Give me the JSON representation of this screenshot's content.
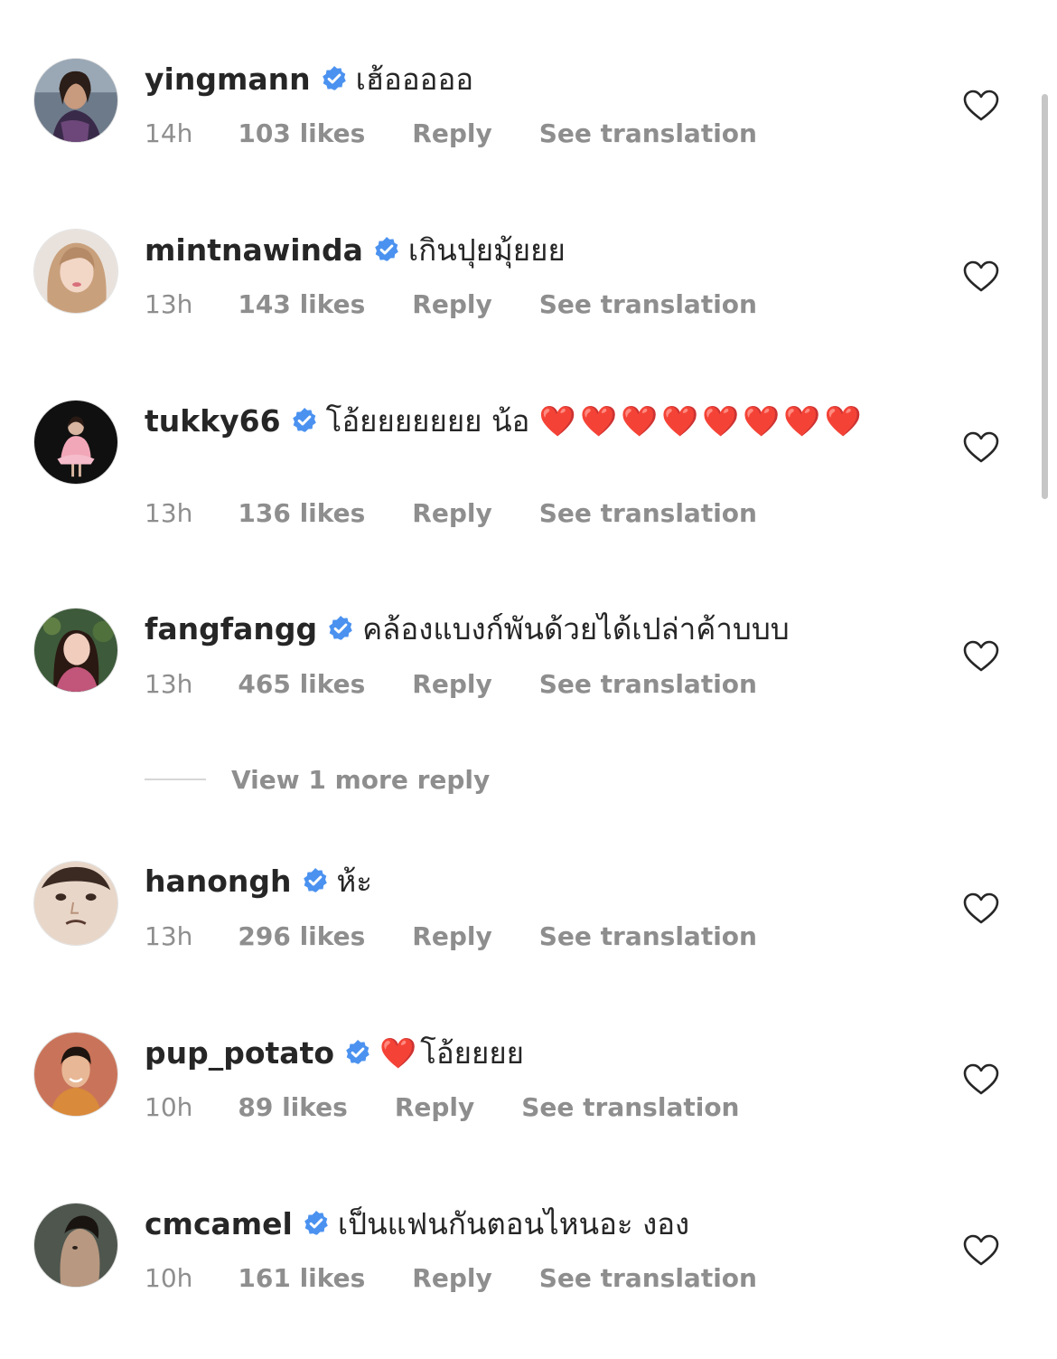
{
  "colors": {
    "verified_badge": "#4b92f0",
    "meta_text": "#8e8e8e",
    "heart_emoji": "#e0283c",
    "scrollbar": "#c6c6c6"
  },
  "comments": [
    {
      "username": "yingmann",
      "text": "เฮ้อออออ",
      "time": "14h",
      "likes": "103 likes",
      "reply": "Reply",
      "translate": "See translation",
      "icon": "heart-outline-icon"
    },
    {
      "username": "mintnawinda",
      "text": "เกินปุยมุ้ยยย",
      "time": "13h",
      "likes": "143 likes",
      "reply": "Reply",
      "translate": "See translation",
      "icon": "heart-outline-icon"
    },
    {
      "username": "tukky66",
      "text": "โอ้ยยยยยยย น้อ",
      "emoji": "❤️❤️❤️❤️❤️❤️❤️❤️",
      "time": "13h",
      "likes": "136 likes",
      "reply": "Reply",
      "translate": "See translation",
      "icon": "heart-outline-icon"
    },
    {
      "username": "fangfangg",
      "text": "คล้องแบงก์พันด้วยได้เปล่าค้าบบบ",
      "time": "13h",
      "likes": "465 likes",
      "reply": "Reply",
      "translate": "See translation",
      "icon": "heart-outline-icon"
    },
    {
      "username": "hanongh",
      "text": "ห้ะ",
      "time": "13h",
      "likes": "296 likes",
      "reply": "Reply",
      "translate": "See translation",
      "icon": "heart-outline-icon"
    },
    {
      "username": "pup_potato",
      "emoji": "❤️",
      "text": "โอ้ยยยย",
      "time": "10h",
      "likes": "89 likes",
      "reply": "Reply",
      "translate": "See translation",
      "icon": "heart-outline-icon"
    },
    {
      "username": "cmcamel",
      "text": "เป็นแฟนกันตอนไหนอะ งอง",
      "time": "10h",
      "likes": "161 likes",
      "reply": "Reply",
      "translate": "See translation",
      "icon": "heart-outline-icon"
    }
  ],
  "more_replies": {
    "label": "View 1 more reply"
  }
}
